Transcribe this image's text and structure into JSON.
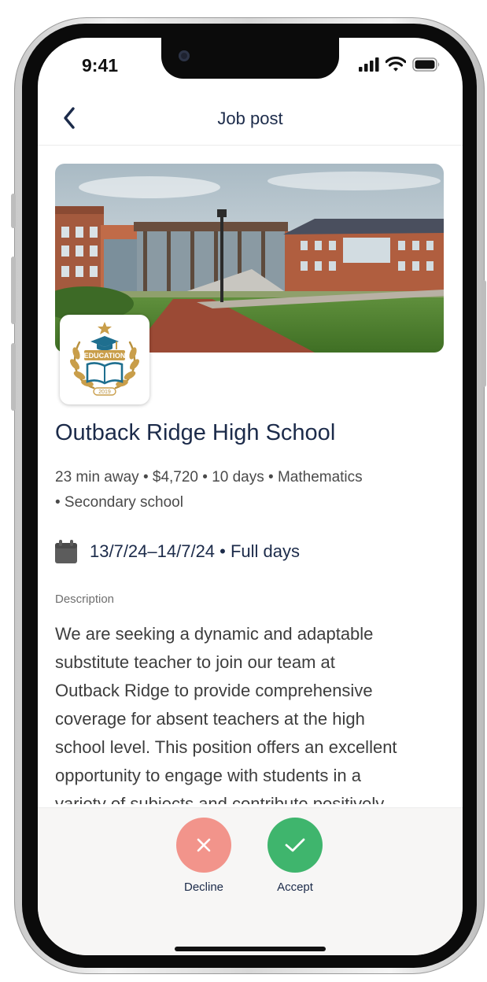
{
  "status_bar": {
    "time": "9:41"
  },
  "header": {
    "title": "Job post"
  },
  "hero": {
    "image": "school-campus-photo",
    "logo": {
      "icon": "education-crest-icon",
      "banner_text": "EDUCATION",
      "year": "2019"
    }
  },
  "job": {
    "school_name": "Outback Ridge High School",
    "meta_lines": [
      "23 min away • $4,720 • 10 days • Mathematics",
      "• Secondary school"
    ],
    "dates": "13/7/24–14/7/24 • Full days",
    "description_label": "Description",
    "description_lines": [
      "We are seeking a dynamic and adaptable",
      "substitute teacher to join our team at",
      "Outback Ridge to provide comprehensive",
      "coverage for absent teachers at the high",
      "school level. This position offers an excellent",
      "opportunity to engage with students in a",
      "variety of subjects and contribute positively"
    ]
  },
  "actions": {
    "decline": {
      "label": "Decline",
      "color": "#f2948b"
    },
    "accept": {
      "label": "Accept",
      "color": "#3fb56d"
    }
  }
}
